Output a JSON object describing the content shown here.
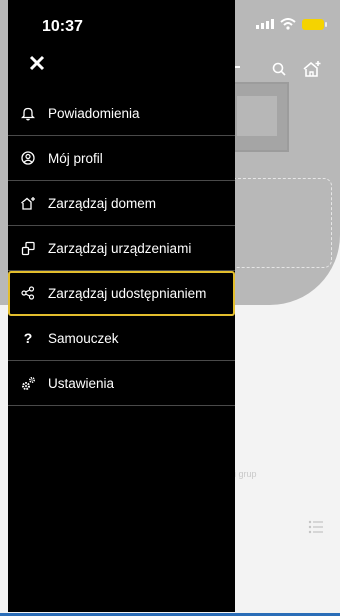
{
  "status_bar": {
    "time": "10:37"
  },
  "drawer": {
    "items": [
      {
        "label": "Powiadomienia",
        "icon": "bell-icon"
      },
      {
        "label": "Mój profil",
        "icon": "profile-icon"
      },
      {
        "label": "Zarządzaj domem",
        "icon": "home-settings-icon"
      },
      {
        "label": "Zarządzaj urządzeniami",
        "icon": "devices-icon"
      },
      {
        "label": "Zarządzaj udostępnianiem",
        "icon": "share-icon",
        "selected": true
      },
      {
        "label": "Samouczek",
        "icon": "question-icon"
      },
      {
        "label": "Ustawienia",
        "icon": "settings-gears-icon"
      }
    ],
    "highlight_color": "#e3be2d"
  },
  "background": {
    "partial_text": "i grup"
  }
}
